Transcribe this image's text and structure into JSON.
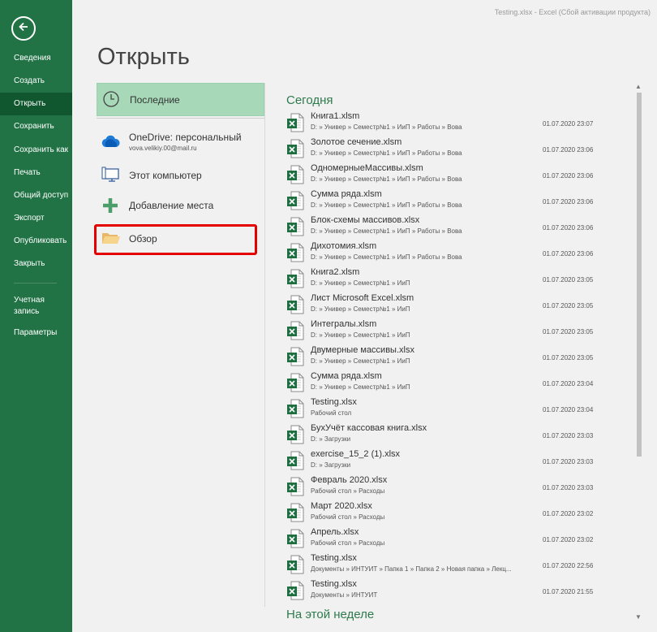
{
  "window": {
    "title": "Testing.xlsx - Excel (Сбой активации продукта)"
  },
  "sidebar": {
    "items": [
      {
        "label": "Сведения"
      },
      {
        "label": "Создать"
      },
      {
        "label": "Открыть"
      },
      {
        "label": "Сохранить"
      },
      {
        "label": "Сохранить как"
      },
      {
        "label": "Печать"
      },
      {
        "label": "Общий доступ"
      },
      {
        "label": "Экспорт"
      },
      {
        "label": "Опубликовать"
      },
      {
        "label": "Закрыть"
      },
      {
        "label": "Учетная запись"
      },
      {
        "label": "Параметры"
      }
    ]
  },
  "page": {
    "title": "Открыть"
  },
  "locations": {
    "recent": "Последние",
    "onedrive": "OneDrive: персональный",
    "onedrive_email": "vova.velikiy.00@mail.ru",
    "computer": "Этот компьютер",
    "add_place": "Добавление места",
    "browse": "Обзор"
  },
  "recent": {
    "today_label": "Сегодня",
    "week_label": "На этой неделе",
    "files": [
      {
        "name": "Книга1.xlsm",
        "path": "D: » Универ » Семестр№1 » ИиП » Работы » Вова",
        "date": "01.07.2020 23:07"
      },
      {
        "name": "Золотое сечение.xlsm",
        "path": "D: » Универ » Семестр№1 » ИиП » Работы » Вова",
        "date": "01.07.2020 23:06"
      },
      {
        "name": "ОдномерныеМассивы.xlsm",
        "path": "D: » Универ » Семестр№1 » ИиП » Работы » Вова",
        "date": "01.07.2020 23:06"
      },
      {
        "name": "Сумма ряда.xlsm",
        "path": "D: » Универ » Семестр№1 » ИиП » Работы » Вова",
        "date": "01.07.2020 23:06"
      },
      {
        "name": "Блок-схемы массивов.xlsx",
        "path": "D: » Универ » Семестр№1 » ИиП » Работы » Вова",
        "date": "01.07.2020 23:06"
      },
      {
        "name": "Дихотомия.xlsm",
        "path": "D: » Универ » Семестр№1 » ИиП » Работы » Вова",
        "date": "01.07.2020 23:06"
      },
      {
        "name": "Книга2.xlsm",
        "path": "D: » Универ » Семестр№1 » ИиП",
        "date": "01.07.2020 23:05"
      },
      {
        "name": "Лист Microsoft Excel.xlsm",
        "path": "D: » Универ » Семестр№1 » ИиП",
        "date": "01.07.2020 23:05"
      },
      {
        "name": "Интегралы.xlsm",
        "path": "D: » Универ » Семестр№1 » ИиП",
        "date": "01.07.2020 23:05"
      },
      {
        "name": "Двумерные массивы.xlsx",
        "path": "D: » Универ » Семестр№1 » ИиП",
        "date": "01.07.2020 23:05"
      },
      {
        "name": "Сумма ряда.xlsm",
        "path": "D: » Универ » Семестр№1 » ИиП",
        "date": "01.07.2020 23:04"
      },
      {
        "name": "Testing.xlsx",
        "path": "Рабочий стол",
        "date": "01.07.2020 23:04"
      },
      {
        "name": "БухУчёт кассовая книга.xlsx",
        "path": "D: » Загрузки",
        "date": "01.07.2020 23:03"
      },
      {
        "name": "exercise_15_2 (1).xlsx",
        "path": "D: » Загрузки",
        "date": "01.07.2020 23:03"
      },
      {
        "name": "Февраль 2020.xlsx",
        "path": "Рабочий стол » Расходы",
        "date": "01.07.2020 23:03"
      },
      {
        "name": "Март 2020.xlsx",
        "path": "Рабочий стол » Расходы",
        "date": "01.07.2020 23:02"
      },
      {
        "name": "Апрель.xlsx",
        "path": "Рабочий стол » Расходы",
        "date": "01.07.2020 23:02"
      },
      {
        "name": "Testing.xlsx",
        "path": "Документы » ИНТУИТ » Папка 1 » Папка 2 » Новая папка » Лекц...",
        "date": "01.07.2020 22:56"
      },
      {
        "name": "Testing.xlsx",
        "path": "Документы » ИНТУИТ",
        "date": "01.07.2020 21:55"
      }
    ]
  },
  "colors": {
    "accent": "#217346",
    "highlight": "#a7d9b9",
    "annotation": "#e50000"
  }
}
